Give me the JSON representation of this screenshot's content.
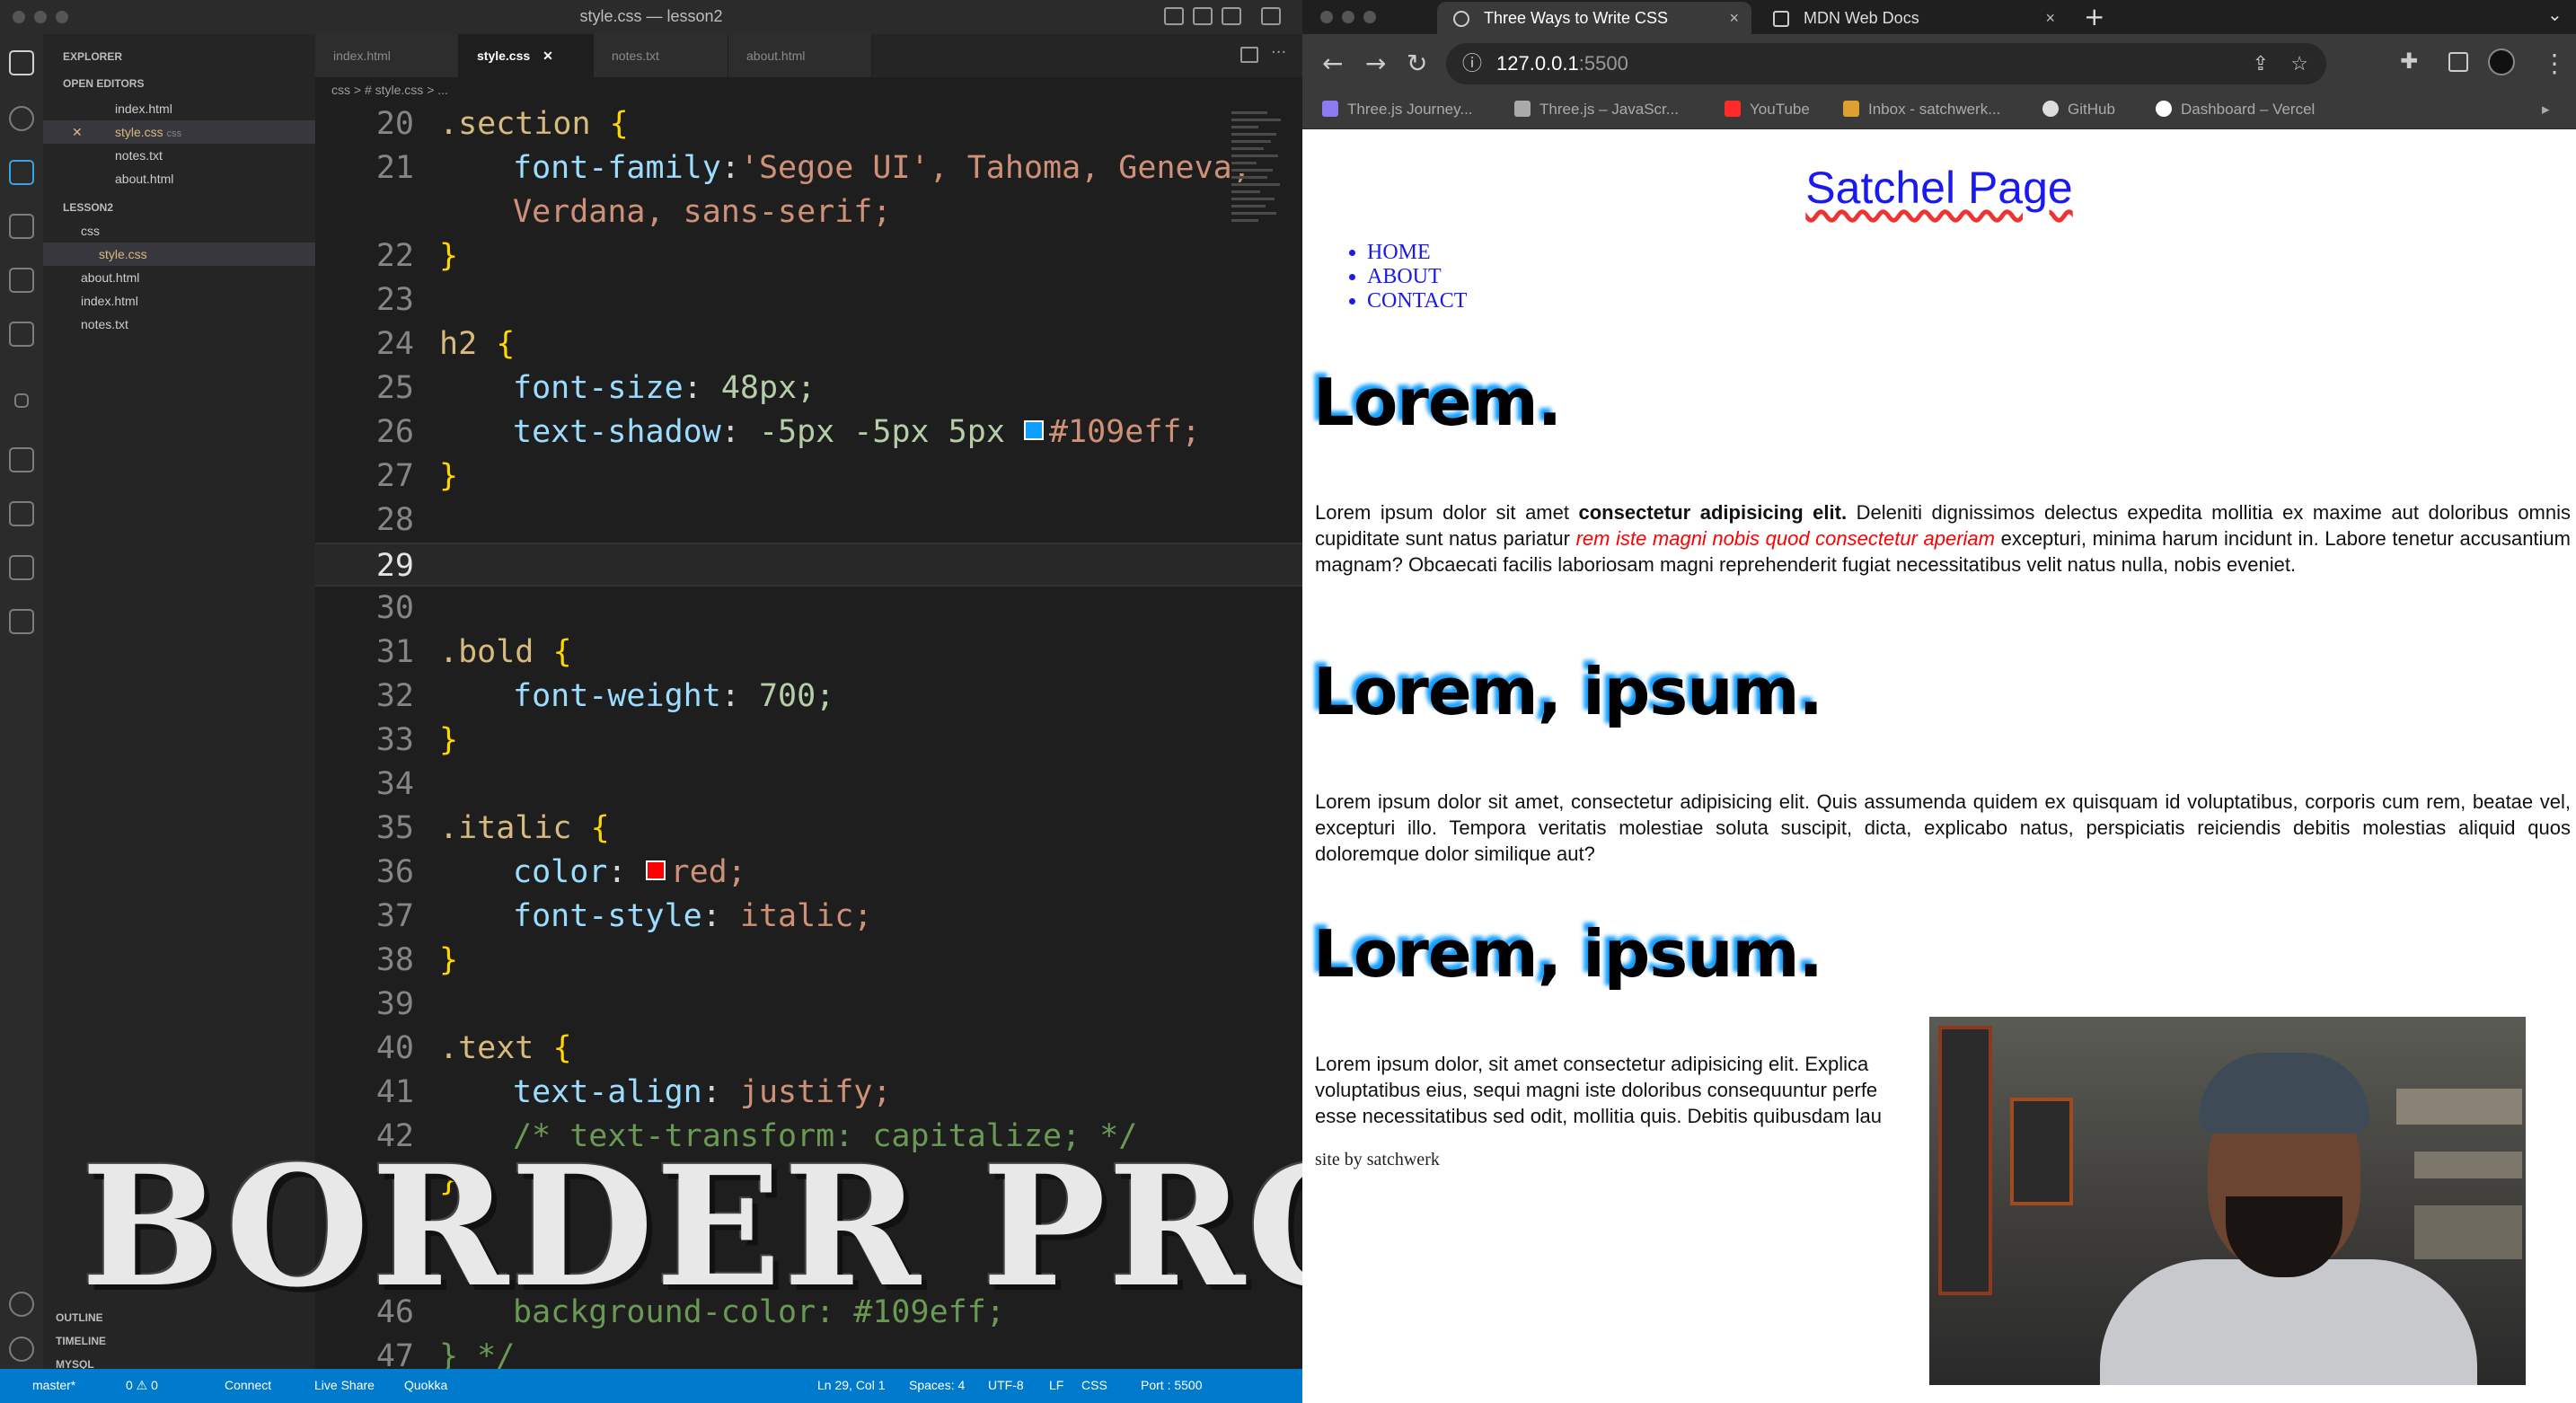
{
  "vscode": {
    "window_title": "style.css — lesson2",
    "explorer_label": "EXPLORER",
    "open_editors_label": "OPEN EDITORS",
    "open_editors": [
      {
        "label": "index.html"
      },
      {
        "label": "style.css",
        "hint": "css"
      },
      {
        "label": "notes.txt"
      },
      {
        "label": "about.html"
      }
    ],
    "workspace_label": "LESSON2",
    "tree": [
      {
        "label": "css"
      },
      {
        "label": "style.css"
      },
      {
        "label": "about.html"
      },
      {
        "label": "index.html"
      },
      {
        "label": "notes.txt"
      }
    ],
    "bottom_panels": [
      "OUTLINE",
      "TIMELINE",
      "MYSQL"
    ],
    "tabs": [
      {
        "label": "index.html"
      },
      {
        "label": "style.css"
      },
      {
        "label": "notes.txt"
      },
      {
        "label": "about.html"
      }
    ],
    "breadcrumb": "css > # style.css > ...",
    "lines": {
      "l20": "20",
      "l21": "21",
      "l22": "22",
      "l23": "23",
      "l24": "24",
      "l25": "25",
      "l26": "26",
      "l27": "27",
      "l28": "28",
      "l29": "29",
      "l30": "30",
      "l31": "31",
      "l32": "32",
      "l33": "33",
      "l34": "34",
      "l35": "35",
      "l36": "36",
      "l37": "37",
      "l38": "38",
      "l39": "39",
      "l40": "40",
      "l41": "41",
      "l42": "42",
      "l46": "46",
      "l47": "47"
    },
    "code": {
      "section_sel": ".section",
      "open": "{",
      "close": "}",
      "ff_prop": "font-family",
      "ff_val1": "'Segoe UI', Tahoma, Geneva,",
      "ff_val2": "Verdana, sans-serif;",
      "h2_sel": "h2",
      "fs_prop": "font-size",
      "fs_val": "48px;",
      "ts_prop": "text-shadow",
      "ts_val": "-5px -5px 5px",
      "ts_color": "#109eff;",
      "bold_sel": ".bold",
      "fw_prop": "font-weight",
      "fw_val": "700;",
      "italic_sel": ".italic",
      "color_prop": "color",
      "color_val": "red;",
      "fst_prop": "font-style",
      "fst_val": "italic;",
      "text_sel": ".text",
      "ta_prop": "text-align",
      "ta_val": "justify;",
      "comment_tt": "/* text-transform: capitalize; */",
      "bg_line": "background-color: #109eff;",
      "close_comment": "} */"
    },
    "swatch_colors": {
      "blue": "#109eff",
      "red": "#ff0000"
    },
    "status": {
      "branch": "master*",
      "counts": "0 ⚠ 0",
      "connect": "Connect",
      "live_share": "Live Share",
      "quokka": "Quokka",
      "position": "Ln 29, Col 1",
      "spaces": "Spaces: 4",
      "encoding": "UTF-8",
      "eol": "LF",
      "lang": "CSS",
      "port": "Port : 5500"
    }
  },
  "overlay_title": "BORDER PROPERTY",
  "chrome": {
    "tabs": [
      {
        "label": "Three Ways to Write CSS",
        "close": "×"
      },
      {
        "label": "MDN Web Docs",
        "close": "×"
      }
    ],
    "new_tab": "+",
    "url_host": "127.0.0.1",
    "url_port": ":5500",
    "bookmarks": [
      {
        "label": "Three.js Journey...",
        "color": "#8a7cf0"
      },
      {
        "label": "Three.js – JavaScr...",
        "color": "#aaaaaa"
      },
      {
        "label": "YouTube",
        "color": "#ff2a2a"
      },
      {
        "label": "Inbox - satchwerk...",
        "color": "#e0a030"
      },
      {
        "label": "GitHub",
        "color": "#dddddd"
      },
      {
        "label": "Dashboard – Vercel",
        "color": "#ffffff"
      }
    ]
  },
  "page": {
    "title": "Satchel Page",
    "nav": [
      "HOME",
      "ABOUT",
      "CONTACT"
    ],
    "heading1": "Lorem.",
    "p1_a": "Lorem ipsum dolor sit amet ",
    "p1_bold": "consectetur adipisicing elit.",
    "p1_b": " Deleniti dignissimos delectus expedita mollitia ex maxime aut doloribus omnis cupiditate sunt natus pariatur ",
    "p1_italic": "rem iste magni nobis quod consectetur aperiam",
    "p1_c": " excepturi, minima harum incidunt in. Labore tenetur accusantium magnam? Obcaecati facilis laboriosam magni reprehenderit fugiat necessitatibus velit natus nulla, nobis eveniet.",
    "heading2": "Lorem, ipsum.",
    "p2": "Lorem ipsum dolor sit amet, consectetur adipisicing elit. Quis assumenda quidem ex quisquam id voluptatibus, corporis cum rem, beatae vel, excepturi illo. Tempora veritatis molestiae soluta suscipit, dicta, explicabo natus, perspiciatis reiciendis debitis molestias aliquid quos doloremque dolor similique aut?",
    "heading3": "Lorem, ipsum.",
    "p3_l1": "Lorem ipsum dolor, sit amet consectetur adipisicing elit. Explica",
    "p3_l2": "voluptatibus eius, sequi magni iste doloribus consequuntur perfe",
    "p3_l3": "esse necessitatibus sed odit, mollitia quis. Debitis quibusdam lau",
    "footer": "site by satchwerk"
  }
}
